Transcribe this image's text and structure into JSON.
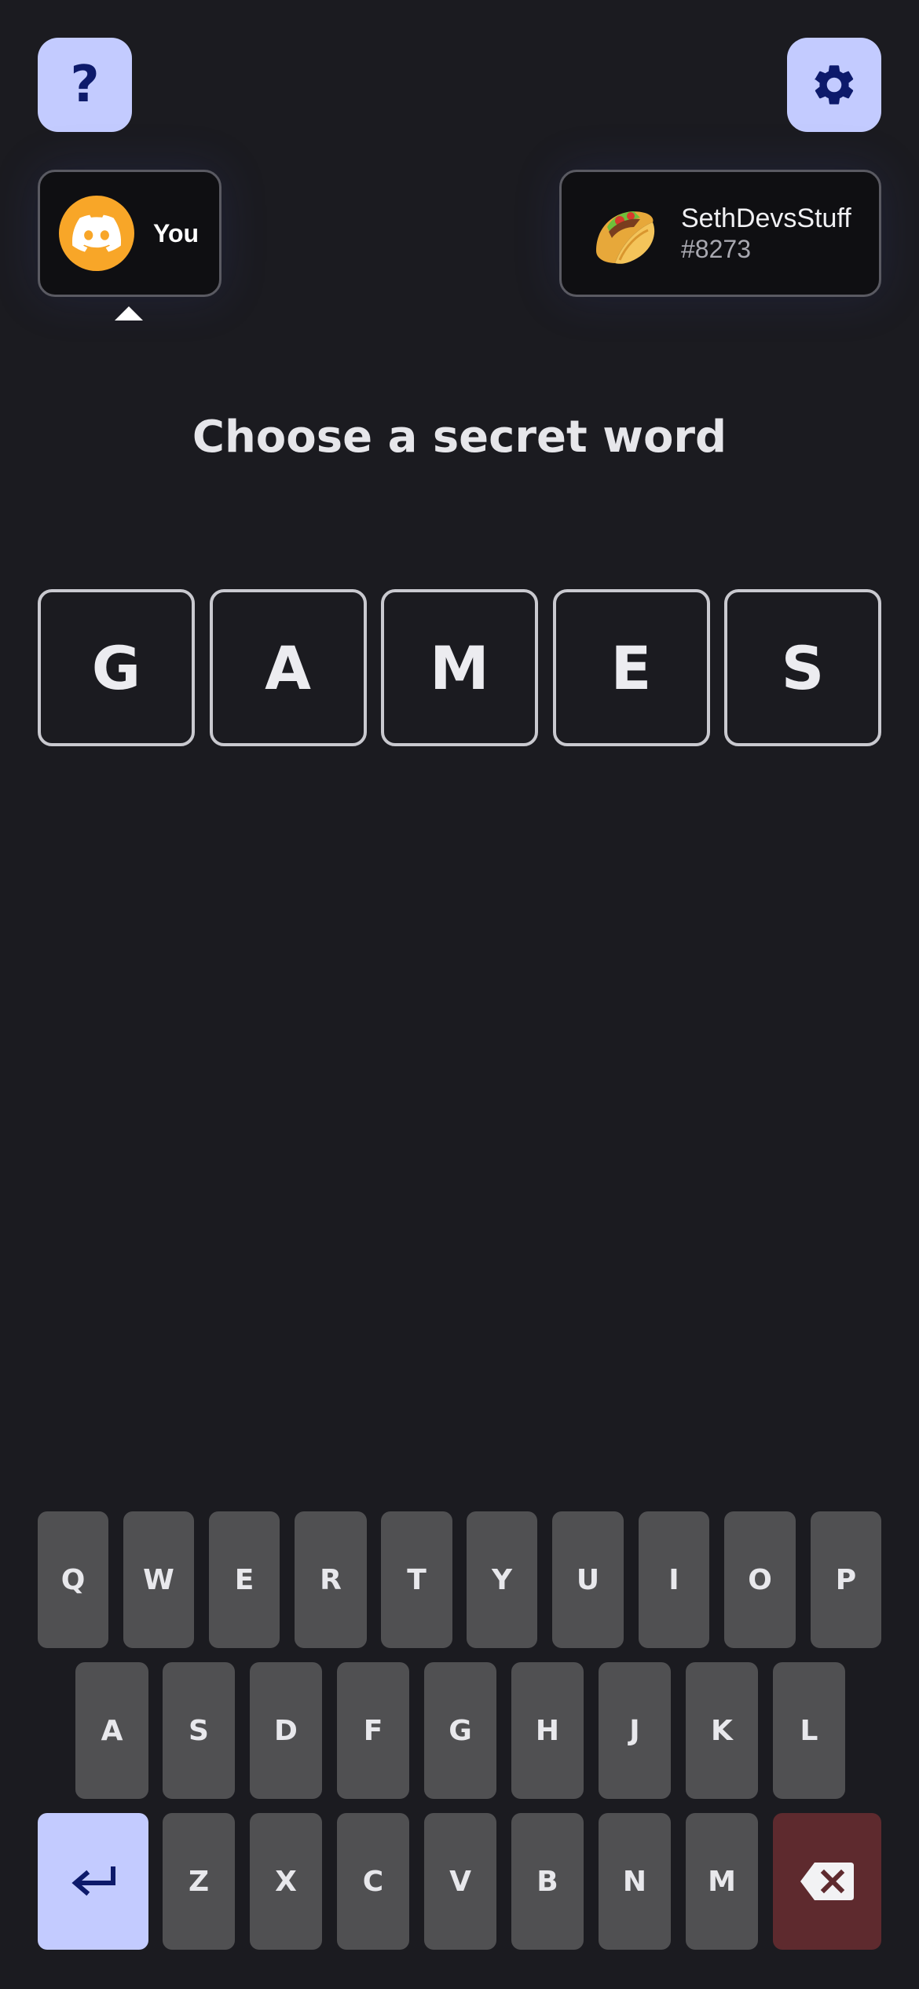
{
  "header": {
    "help_icon": "question-mark-icon",
    "settings_icon": "gear-icon"
  },
  "players": {
    "you": {
      "label": "You",
      "avatar_icon": "discord-logo-icon",
      "avatar_color": "#f8a628"
    },
    "opponent": {
      "name": "SethDevsStuff",
      "tag": "#8273",
      "avatar_icon": "taco-icon"
    }
  },
  "prompt": "Choose a secret word",
  "word_tiles": [
    "G",
    "A",
    "M",
    "E",
    "S"
  ],
  "keyboard": {
    "row1": [
      "Q",
      "W",
      "E",
      "R",
      "T",
      "Y",
      "U",
      "I",
      "O",
      "P"
    ],
    "row2": [
      "A",
      "S",
      "D",
      "F",
      "G",
      "H",
      "J",
      "K",
      "L"
    ],
    "row3": [
      "Z",
      "X",
      "C",
      "V",
      "B",
      "N",
      "M"
    ],
    "enter_icon": "enter-arrow-icon",
    "backspace_icon": "backspace-icon"
  },
  "colors": {
    "background": "#1b1b20",
    "accent": "#c3cbff",
    "key": "#505052",
    "backspace": "#5e2a2e"
  }
}
